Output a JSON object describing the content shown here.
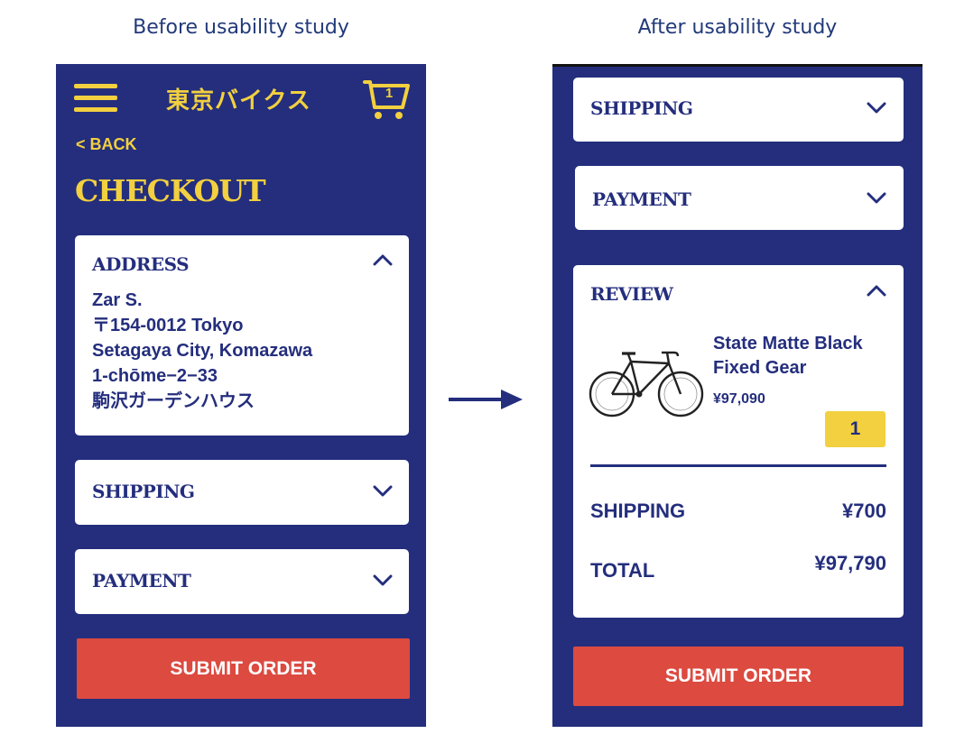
{
  "captions": {
    "before": "Before usability study",
    "after": "After usability study"
  },
  "colors": {
    "navy": "#242e7d",
    "yellow": "#f2d03f",
    "red": "#dc4a40",
    "white": "#ffffff"
  },
  "before": {
    "header": {
      "menu_icon": "hamburger-menu-icon",
      "brand": "東京バイクス",
      "cart_icon": "shopping-cart-icon",
      "cart_count": "1"
    },
    "back_label": "< BACK",
    "title": "CHECKOUT",
    "sections": {
      "address": {
        "title": "ADDRESS",
        "state_icon": "chevron-up-icon",
        "lines": [
          "Zar S.",
          "〒154-0012 Tokyo",
          "Setagaya City, Komazawa",
          "1-chōme−2−33",
          "駒沢ガーデンハウス"
        ]
      },
      "shipping": {
        "title": "SHIPPING",
        "state_icon": "chevron-down-icon"
      },
      "payment": {
        "title": "PAYMENT",
        "state_icon": "chevron-down-icon"
      }
    },
    "submit_label": "SUBMIT ORDER"
  },
  "after": {
    "sections": {
      "shipping": {
        "title": "SHIPPING",
        "state_icon": "chevron-down-icon"
      },
      "payment": {
        "title": "PAYMENT",
        "state_icon": "chevron-down-icon"
      },
      "review": {
        "title": "REVIEW",
        "state_icon": "chevron-up-icon",
        "product": {
          "image_icon": "bicycle-icon",
          "name_lines": [
            "State Matte Black",
            "Fixed Gear"
          ],
          "price": "¥97,090",
          "quantity": "1"
        },
        "shipping_label": "SHIPPING",
        "shipping_value": "¥700",
        "total_label": "TOTAL",
        "total_value": "¥97,790"
      }
    },
    "submit_label": "SUBMIT ORDER"
  },
  "transition_icon": "right-arrow-icon"
}
